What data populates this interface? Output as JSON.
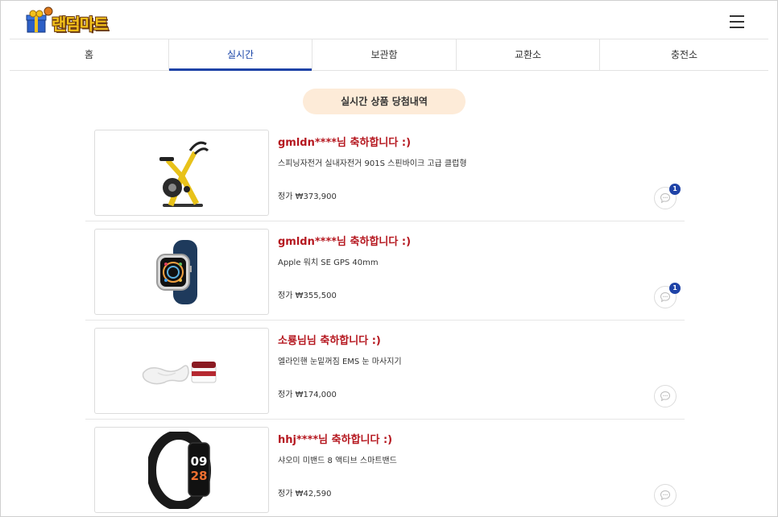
{
  "header": {
    "logo_text": "랜덤마트",
    "menu_icon": "hamburger-menu-icon"
  },
  "tabs": [
    {
      "label": "홈"
    },
    {
      "label": "실시간",
      "active": true
    },
    {
      "label": "보관함"
    },
    {
      "label": "교환소"
    },
    {
      "label": "충전소"
    }
  ],
  "section_title": "실시간 상품 당첨내역",
  "colors": {
    "accent": "#1f43a7",
    "winner_text": "#b5171f",
    "pill_bg": "#fdebd8"
  },
  "items": [
    {
      "winner": "gmldn****님 축하합니다 :)",
      "product": "스피닝자전거 실내자전거 901S 스핀바이크 고급 클럽형",
      "price": "정가 ₩373,900",
      "badge": "1",
      "image": "spin-bike"
    },
    {
      "winner": "gmldn****님 축하합니다 :)",
      "product": "Apple 워치 SE GPS 40mm",
      "price": "정가 ₩355,500",
      "badge": "1",
      "image": "apple-watch"
    },
    {
      "winner": "소룡님님 축하합니다 :)",
      "product": "엘라인핸 눈밑꺼짐 EMS 눈 마사지기",
      "price": "정가 ₩174,000",
      "badge": "",
      "image": "eye-massager"
    },
    {
      "winner": "hhj****님 축하합니다 :)",
      "product": "샤오미 미밴드 8 액티브 스마트밴드",
      "price": "정가 ₩42,590",
      "badge": "",
      "image": "smart-band"
    }
  ],
  "smart_band_screen": {
    "line1": "09",
    "line2": "28"
  }
}
